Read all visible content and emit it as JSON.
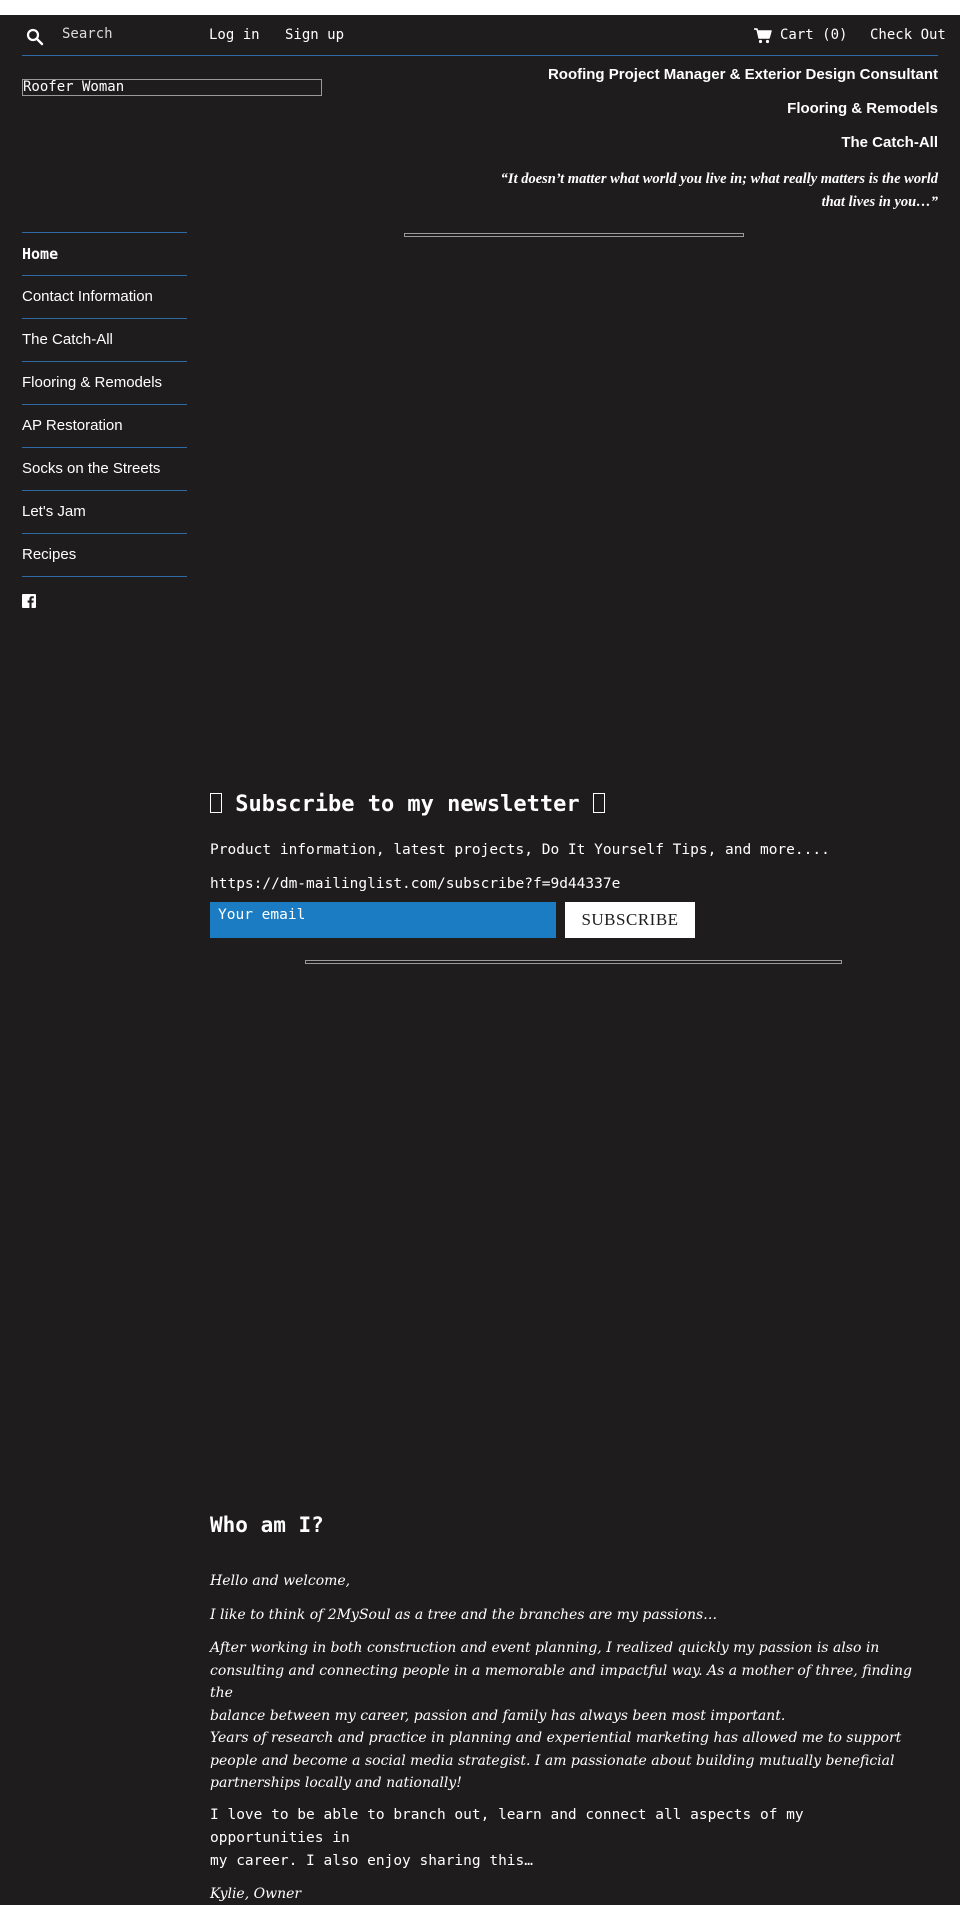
{
  "topbar": {
    "search_placeholder": "Search",
    "login_label": "Log in",
    "signup_label": "Sign up",
    "cart_label": "Cart (0)",
    "checkout_label": "Check Out"
  },
  "logo": {
    "text": "Roofer Woman"
  },
  "header": {
    "line1": "Roofing Project Manager & Exterior Design Consultant",
    "line2": "Flooring & Remodels",
    "line3": "The Catch-All",
    "quote_line1": "“It doesn’t matter what world you live in; what really matters is the world",
    "quote_line2": "that lives in you…”"
  },
  "sidebar": {
    "items": [
      {
        "label": "Home"
      },
      {
        "label": "Contact Information"
      },
      {
        "label": "The Catch-All"
      },
      {
        "label": "Flooring & Remodels"
      },
      {
        "label": "AP Restoration"
      },
      {
        "label": "Socks on the Streets"
      },
      {
        "label": "Let's Jam"
      },
      {
        "label": "Recipes"
      }
    ]
  },
  "newsletter": {
    "title": "Subscribe to my newsletter",
    "description": "Product information, latest projects, Do It Yourself Tips, and more....",
    "url": "https://dm-mailinglist.com/subscribe?f=9d44337e",
    "email_placeholder": "Your email",
    "subscribe_label": "SUBSCRIBE"
  },
  "about": {
    "title": "Who am I?",
    "p1": "Hello and welcome,",
    "p2": "I like to think of 2MySoul as a tree and the branches are my passions…",
    "p3_l1": "After working in both construction and event planning, I realized quickly my passion is also in",
    "p3_l2": "consulting and connecting people in a memorable and impactful way. As a mother of three, finding the",
    "p3_l3": "balance between my career, passion and family has always been most important.",
    "p3_l4": "Years of research and practice in planning and experiential marketing has allowed me to support",
    "p3_l5": "people and become a social media strategist. I am passionate about building mutually beneficial",
    "p3_l6": "partnerships locally and nationally!",
    "p4_l1": "I love to be able to branch out, learn and connect all aspects of my opportunities in",
    "p4_l2": "my career. I also enjoy sharing this…",
    "signature": "Kylie, Owner"
  },
  "colors": {
    "background": "#1e1c1d",
    "accent": "#1c7cc3",
    "rule": "#2f6aa3"
  }
}
